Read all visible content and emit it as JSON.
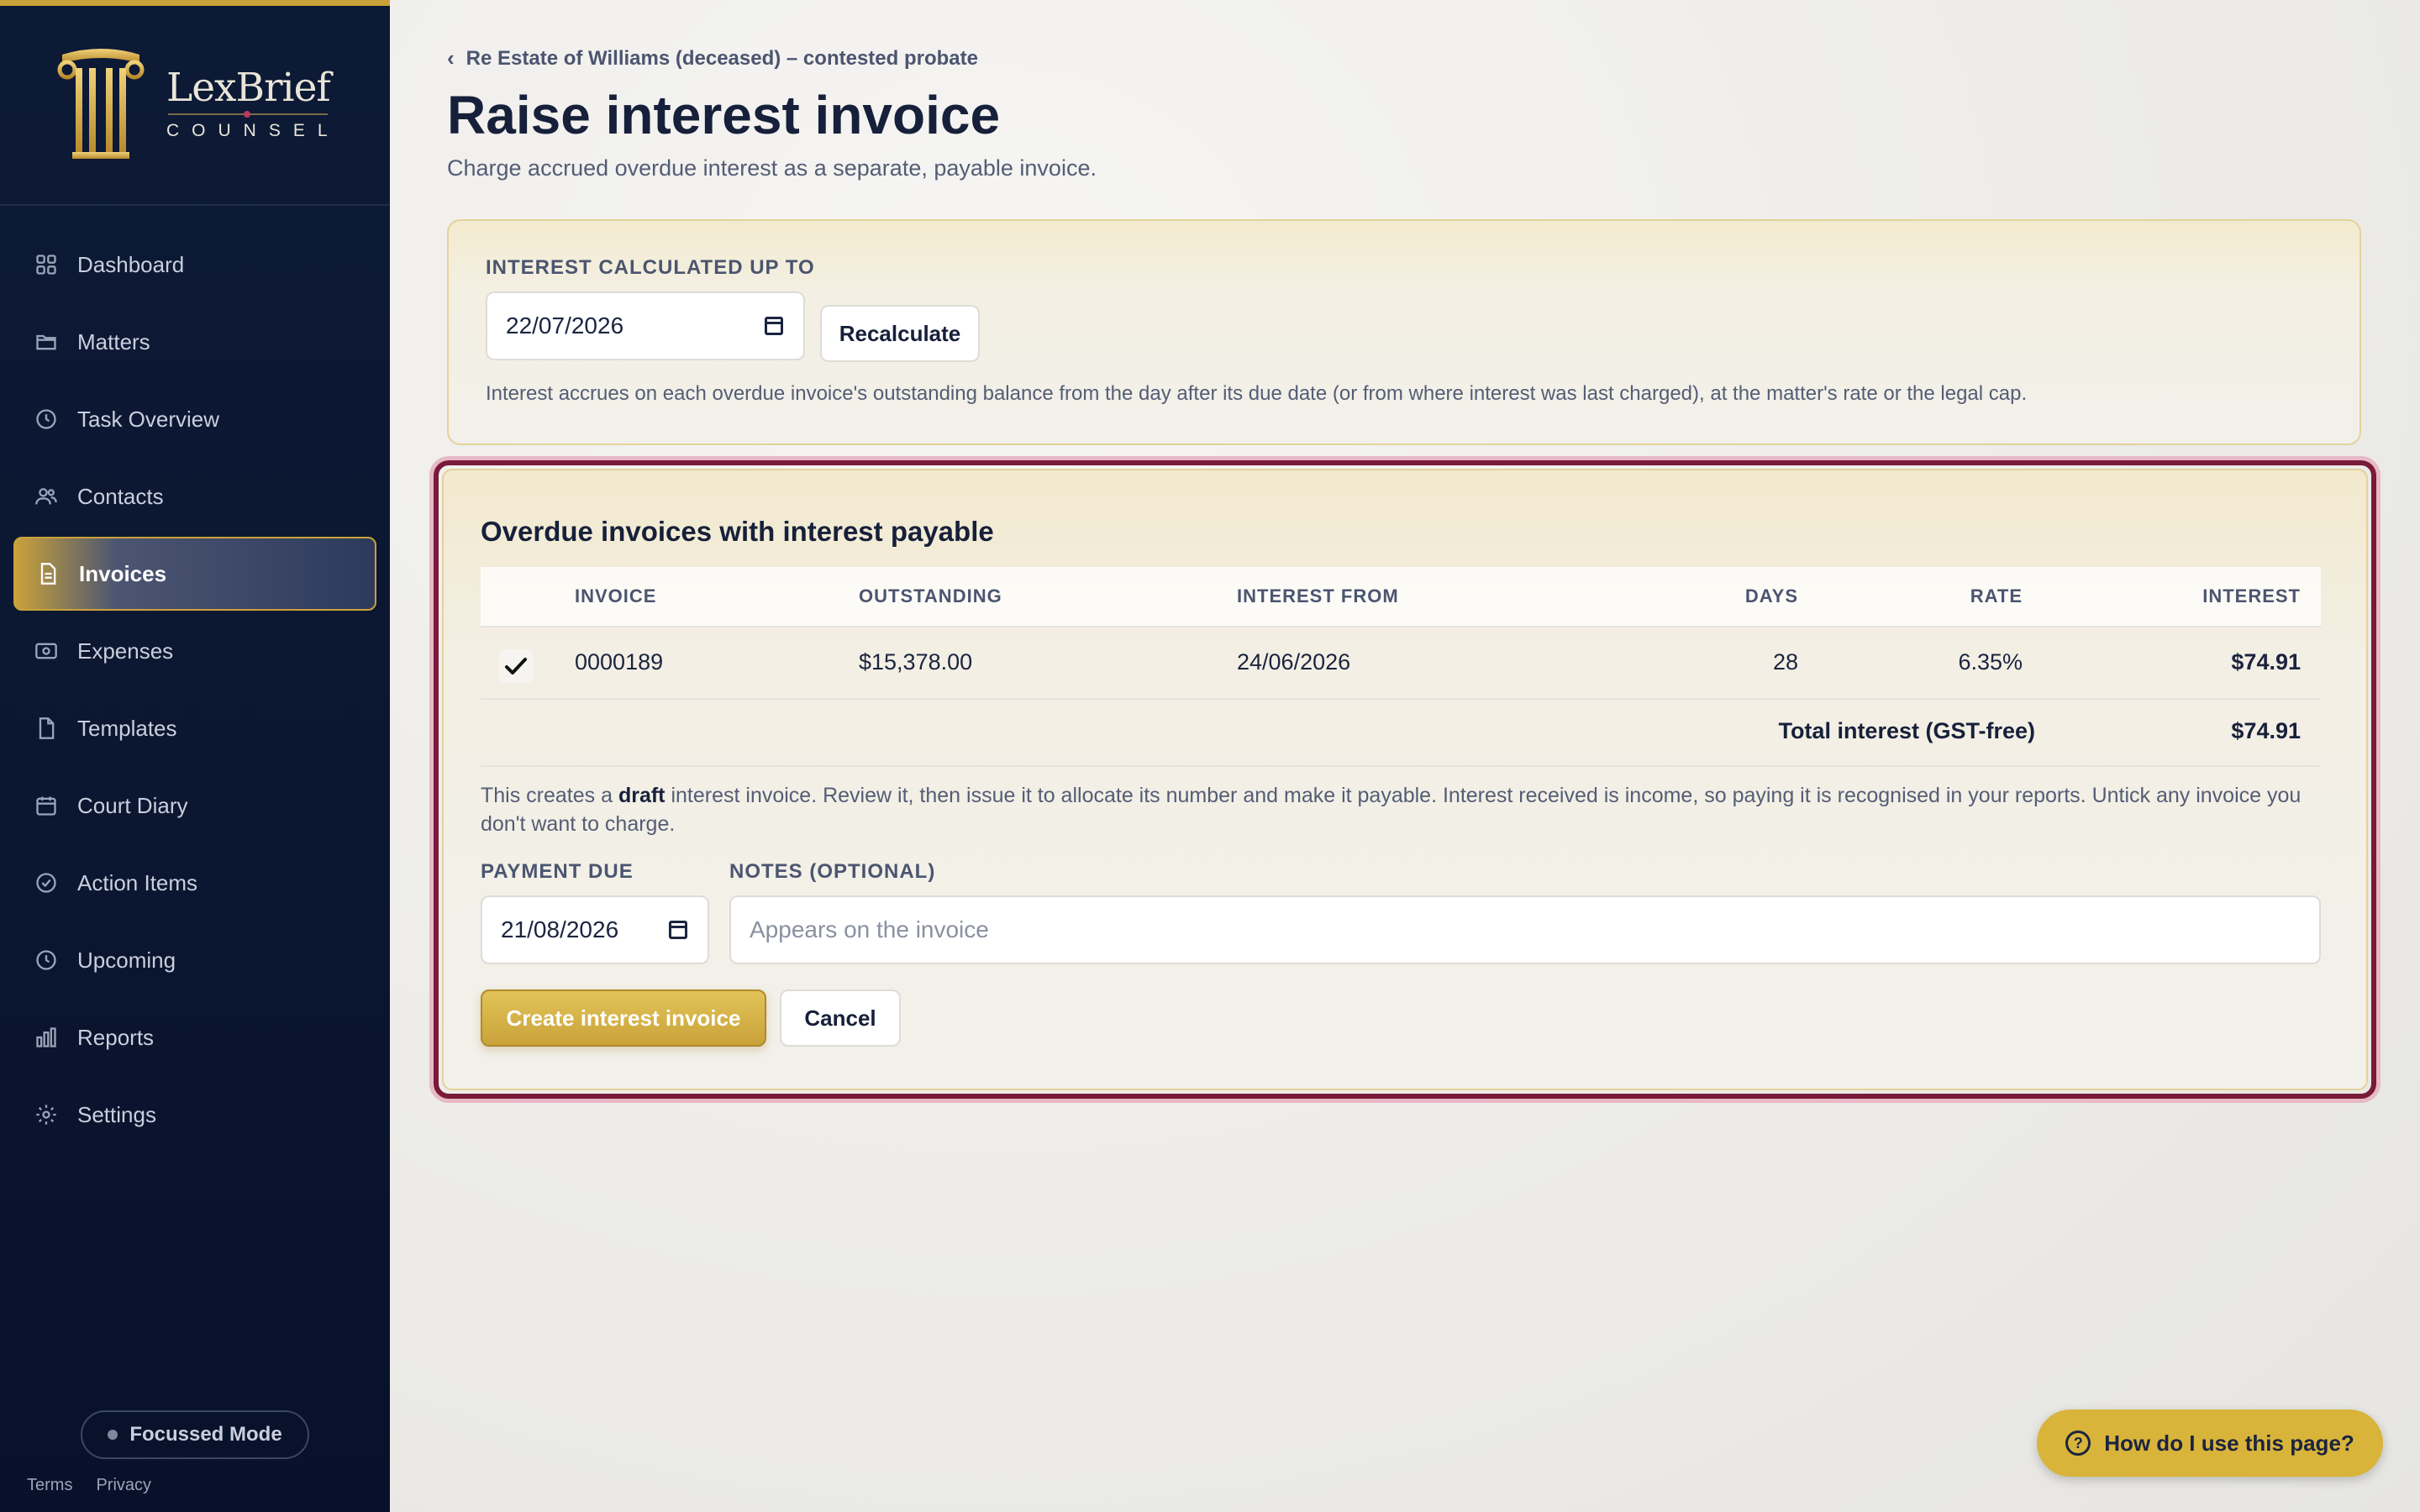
{
  "app": {
    "brand_name": "LexBrief",
    "brand_sub": "COUNSEL"
  },
  "colors": {
    "accent_gold": "#c9a23a",
    "sidebar_bg": "#0d1a36",
    "highlight_border": "#7a1a3a"
  },
  "sidebar": {
    "items": [
      {
        "label": "Dashboard",
        "icon": "grid-icon"
      },
      {
        "label": "Matters",
        "icon": "folder-icon"
      },
      {
        "label": "Task Overview",
        "icon": "clock-icon"
      },
      {
        "label": "Contacts",
        "icon": "users-icon"
      },
      {
        "label": "Invoices",
        "icon": "document-icon",
        "active": true
      },
      {
        "label": "Expenses",
        "icon": "receipt-icon"
      },
      {
        "label": "Templates",
        "icon": "file-icon"
      },
      {
        "label": "Court Diary",
        "icon": "calendar-icon"
      },
      {
        "label": "Action Items",
        "icon": "check-circle-icon"
      },
      {
        "label": "Upcoming",
        "icon": "clock-icon"
      },
      {
        "label": "Reports",
        "icon": "bar-chart-icon"
      },
      {
        "label": "Settings",
        "icon": "gear-icon"
      }
    ],
    "focus_mode": "Focussed Mode",
    "footer": {
      "terms": "Terms",
      "privacy": "Privacy"
    }
  },
  "header": {
    "breadcrumb": "Re Estate of Williams (deceased) – contested probate",
    "title": "Raise interest invoice",
    "subtitle": "Charge accrued overdue interest as a separate, payable invoice."
  },
  "calc": {
    "label": "INTEREST CALCULATED UP TO",
    "date": "22/07/2026",
    "recalc_label": "Recalculate",
    "info": "Interest accrues on each overdue invoice's outstanding balance from the day after its due date (or from where interest was last charged), at the matter's rate or the legal cap."
  },
  "overdue": {
    "title": "Overdue invoices with interest payable",
    "columns": [
      "INVOICE",
      "OUTSTANDING",
      "INTEREST FROM",
      "DAYS",
      "RATE",
      "INTEREST"
    ],
    "rows": [
      {
        "checked": true,
        "invoice": "0000189",
        "outstanding": "$15,378.00",
        "interest_from": "24/06/2026",
        "days": "28",
        "rate": "6.35%",
        "interest": "$74.91"
      }
    ],
    "total_label": "Total interest (GST-free)",
    "total_value": "$74.91",
    "note_prefix": "This creates a ",
    "note_bold": "draft",
    "note_suffix": " interest invoice. Review it, then issue it to allocate its number and make it payable. Interest received is income, so paying it is recognised in your reports. Untick any invoice you don't want to charge.",
    "payment_due_label": "PAYMENT DUE",
    "payment_due": "21/08/2026",
    "notes_label": "NOTES (OPTIONAL)",
    "notes_placeholder": "Appears on the invoice",
    "create_label": "Create interest invoice",
    "cancel_label": "Cancel"
  },
  "help": {
    "label": "How do I use this page?"
  }
}
